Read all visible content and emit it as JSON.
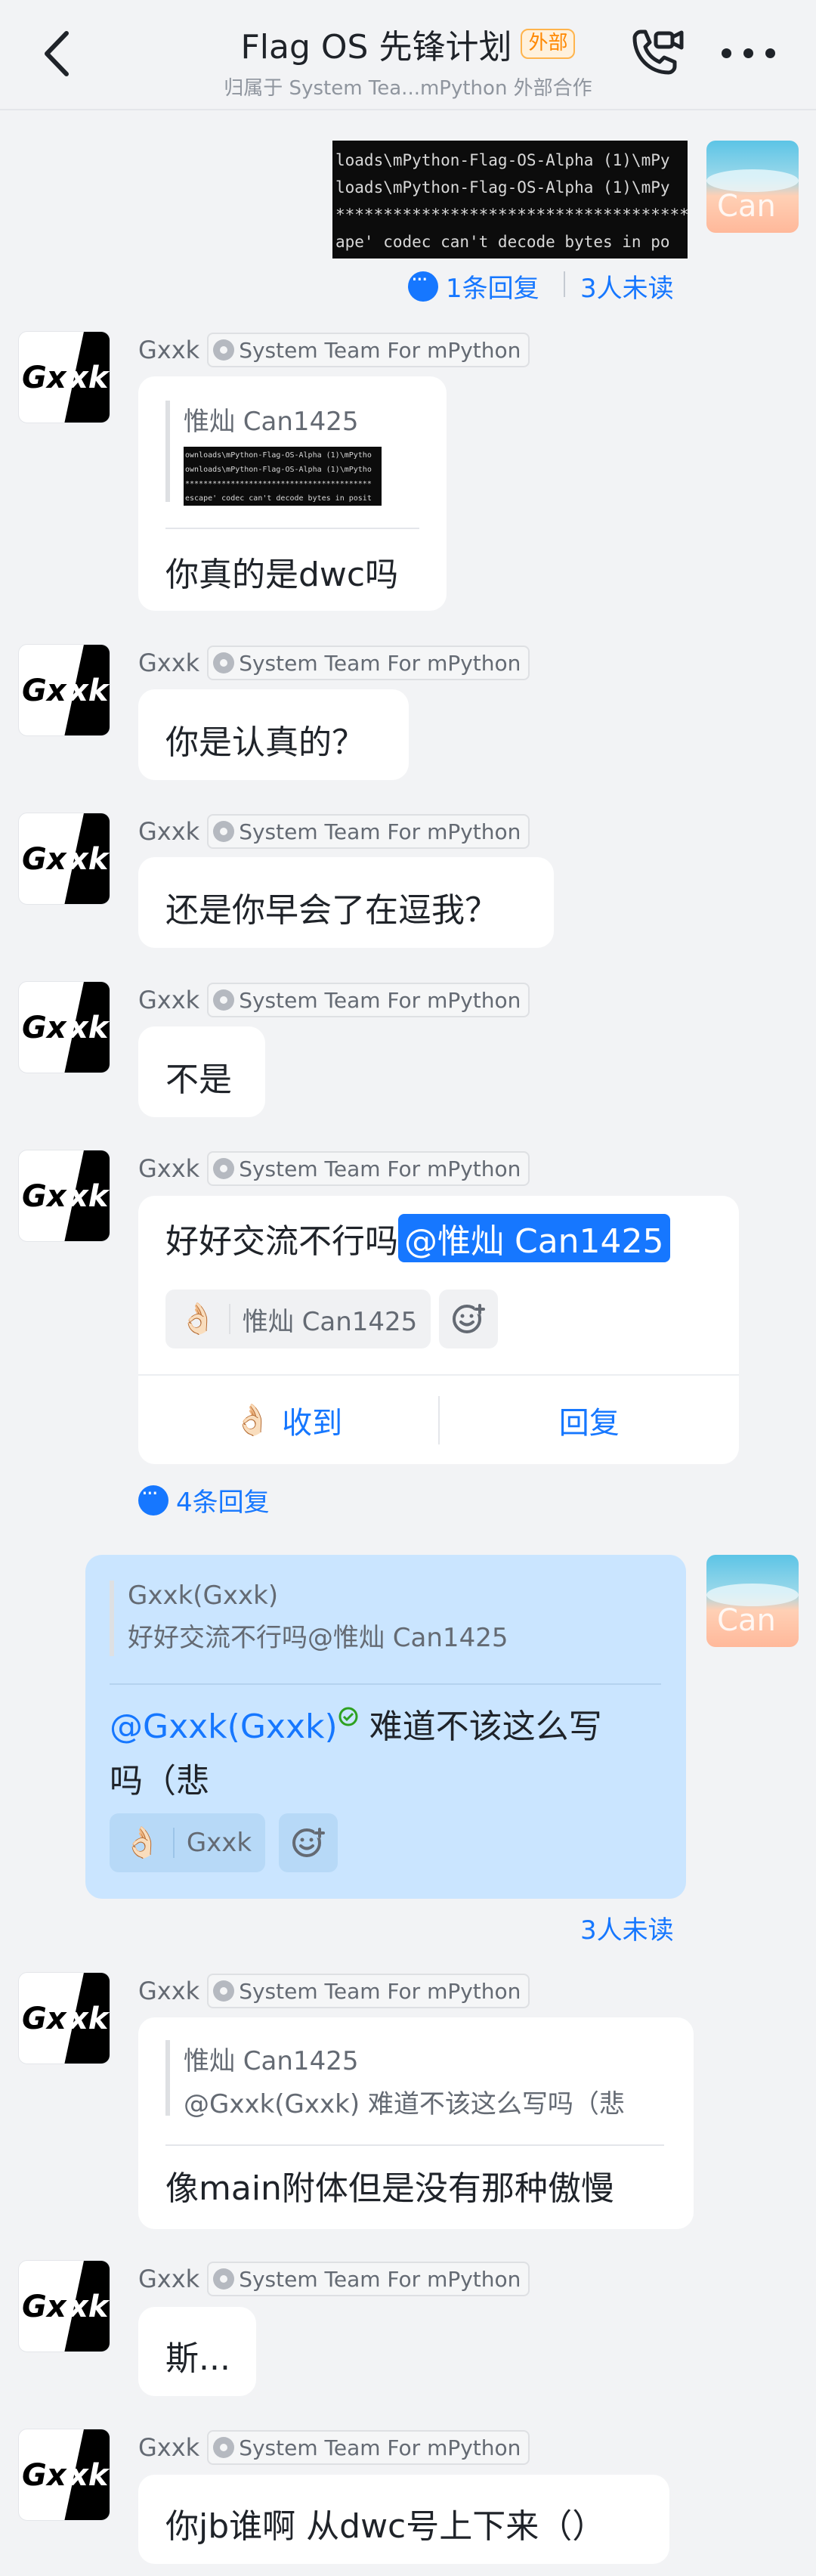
{
  "header": {
    "title": "Flag OS 先锋计划",
    "badge": "外部",
    "subtitle": "归属于 System Tea...mPython 外部合作"
  },
  "common": {
    "team_tag": "System Team For mPython",
    "gxxk_avatar_left": "Gx",
    "gxxk_avatar_right": "xk",
    "can_avatar_text": "Can"
  },
  "messages": {
    "m0": {
      "terminal_lines": [
        "loads\\mPython-Flag-OS-Alpha (1)\\mPy",
        "loads\\mPython-Flag-OS-Alpha (1)\\mPy",
        "**************************************",
        "ape' codec can't decode bytes in po"
      ],
      "reply_count": "1条回复",
      "unread": "3人未读"
    },
    "m1": {
      "sender": "Gxxk",
      "quote_name": "惟灿 Can1425",
      "quote_terminal_lines": [
        "ownloads\\mPython-Flag-OS-Alpha (1)\\mPytho",
        "ownloads\\mPython-Flag-OS-Alpha (1)\\mPytho",
        "*****************************************",
        "escape' codec can't decode bytes in posit"
      ],
      "text": "你真的是dwc吗"
    },
    "m2": {
      "sender": "Gxxk",
      "text": "你是认真的？"
    },
    "m3": {
      "sender": "Gxxk",
      "text": "还是你早会了在逗我？"
    },
    "m4": {
      "sender": "Gxxk",
      "text": "不是"
    },
    "m5": {
      "sender": "Gxxk",
      "text": "好好交流不行吗",
      "mention": "@惟灿 Can1425",
      "reaction_emoji": "👌🏻",
      "reaction_user": "惟灿 Can1425",
      "btn_received": "收到",
      "btn_reply": "回复",
      "reply_count": "4条回复"
    },
    "m6": {
      "quote_name": "Gxxk(Gxxk)",
      "quote_text": "好好交流不行吗@惟灿 Can1425",
      "mention": "@Gxxk(Gxxk)",
      "text_line1": " 难道不该这么写",
      "text_line2": "吗（悲",
      "reaction_emoji": "👌🏻",
      "reaction_user": "Gxxk",
      "unread": "3人未读"
    },
    "m7": {
      "sender": "Gxxk",
      "quote_name": "惟灿 Can1425",
      "quote_text": "@Gxxk(Gxxk) 难道不该这么写吗（悲",
      "text": "像main附体但是没有那种傲慢"
    },
    "m8": {
      "sender": "Gxxk",
      "text": "斯..."
    },
    "m9": {
      "sender": "Gxxk",
      "text": "你jb谁啊 从dwc号上下来（）"
    }
  },
  "colors": {
    "accent": "#1677ff",
    "self_bubble": "#cae5ff",
    "background": "#f2f3f5",
    "badge_orange": "#ff8800"
  }
}
